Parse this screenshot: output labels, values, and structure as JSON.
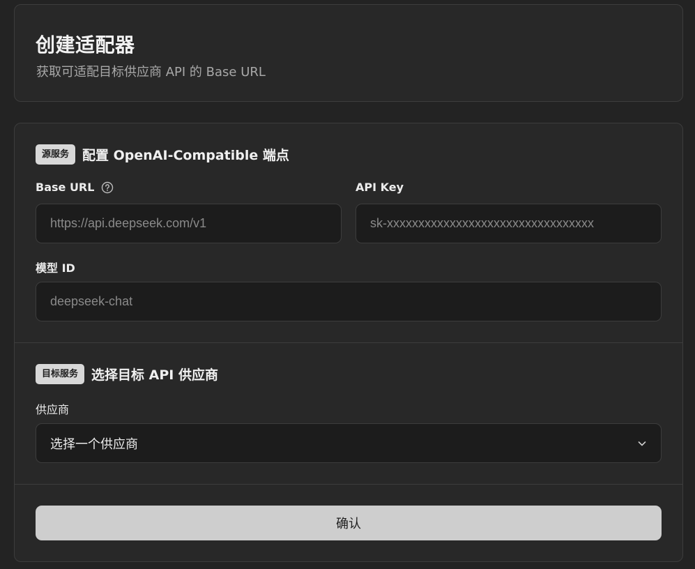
{
  "header": {
    "title": "创建适配器",
    "subtitle": "获取可适配目标供应商 API 的 Base URL"
  },
  "source_section": {
    "badge": "源服务",
    "title": "配置 OpenAI-Compatible 端点",
    "base_url_label": "Base URL",
    "base_url_placeholder": "https://api.deepseek.com/v1",
    "api_key_label": "API Key",
    "api_key_placeholder": "sk-xxxxxxxxxxxxxxxxxxxxxxxxxxxxxxxxx",
    "model_id_label": "模型 ID",
    "model_id_placeholder": "deepseek-chat"
  },
  "target_section": {
    "badge": "目标服务",
    "title": "选择目标 API 供应商",
    "provider_label": "供应商",
    "provider_selected": "选择一个供应商"
  },
  "actions": {
    "confirm_label": "确认"
  },
  "icons": {
    "help": "help-circle-icon",
    "chevron": "chevron-down-icon"
  }
}
